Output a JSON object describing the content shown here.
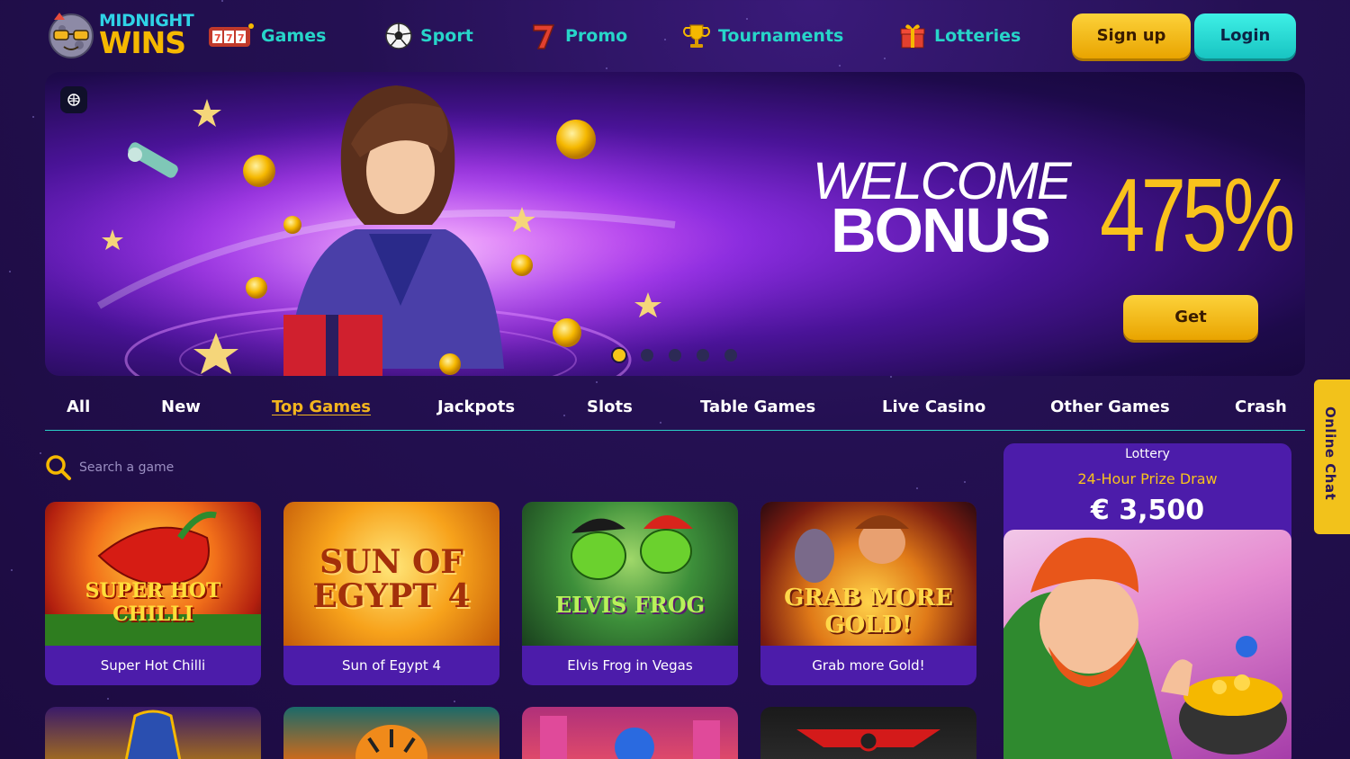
{
  "brand": {
    "line1": "MIDNIGHT",
    "line2": "WINS"
  },
  "nav": [
    {
      "label": "Games",
      "icon": "slot-machine-icon"
    },
    {
      "label": "Sport",
      "icon": "soccer-ball-icon"
    },
    {
      "label": "Promo",
      "icon": "lucky-seven-icon"
    },
    {
      "label": "Tournaments",
      "icon": "trophy-icon"
    },
    {
      "label": "Lotteries",
      "icon": "gift-box-icon"
    }
  ],
  "auth": {
    "signup": "Sign up",
    "login": "Login"
  },
  "hero": {
    "line1": "WELCOME",
    "line2": "BONUS",
    "percent": "475%",
    "cta": "Get",
    "slides": 5,
    "active_slide": 1
  },
  "tabs": [
    "All",
    "New",
    "Top Games",
    "Jackpots",
    "Slots",
    "Table Games",
    "Live Casino",
    "Other Games",
    "Crash"
  ],
  "active_tab": "Top Games",
  "search": {
    "placeholder": "Search a game"
  },
  "games": [
    {
      "title": "Super Hot Chilli",
      "art": "SUPER HOT\nCHILLI"
    },
    {
      "title": "Sun of Egypt 4",
      "art": "SUN OF EGYPT 4"
    },
    {
      "title": "Elvis Frog in Vegas",
      "art": "ELVIS FROG"
    },
    {
      "title": "Grab more Gold!",
      "art": "GRAB MORE GOLD!"
    }
  ],
  "lottery": {
    "label": "Lottery",
    "name": "24-Hour Prize Draw",
    "amount": "€ 3,500"
  },
  "chat": {
    "label": "Online Chat"
  },
  "colors": {
    "accent_teal": "#27d5c9",
    "accent_gold": "#f5b800",
    "card_bg": "#4c1caa",
    "bg": "#1c0b40"
  }
}
